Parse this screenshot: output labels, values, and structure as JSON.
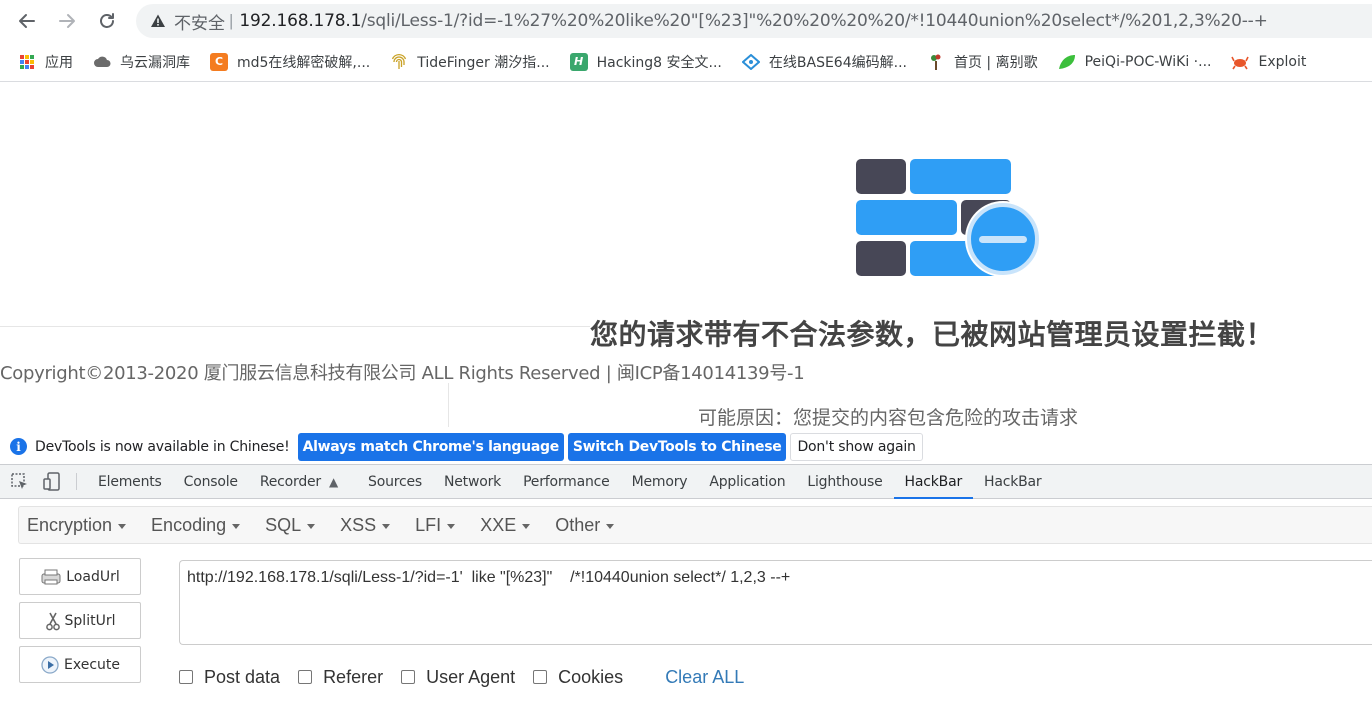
{
  "address_bar": {
    "insecure_label": "不安全",
    "separator": "|",
    "host": "192.168.178.1",
    "path": "/sqli/Less-1/?id=-1%27%20%20like%20\"[%23]\"%20%20%20%20/*!10440union%20select*/%201,2,3%20--+"
  },
  "bookmarks": [
    {
      "label": "应用",
      "icon": "apps-grid-icon"
    },
    {
      "label": "乌云漏洞库",
      "icon": "cloud-icon"
    },
    {
      "label": "md5在线解密破解,...",
      "icon": "cmd5-icon"
    },
    {
      "label": "TideFinger 潮汐指...",
      "icon": "fingerprint-icon"
    },
    {
      "label": "Hacking8 安全文...",
      "icon": "hacking8-icon"
    },
    {
      "label": "在线BASE64编码解...",
      "icon": "base64-icon"
    },
    {
      "label": "首页 | 离别歌",
      "icon": "plant-icon"
    },
    {
      "label": "PeiQi-POC-WiKi ·...",
      "icon": "leaf-icon"
    },
    {
      "label": "Exploit",
      "icon": "crab-icon"
    }
  ],
  "block_page": {
    "title": "您的请求带有不合法参数，已被网站管理员设置拦截！",
    "copyright": "Copyright©2013-2020 厦门服云信息科技有限公司 ALL Rights Reserved | 闽ICP备14014139号-1",
    "reason": "可能原因：您提交的内容包含危险的攻击请求",
    "colors": {
      "brick_dark": "#474756",
      "brick_blue": "#2f9ef5"
    }
  },
  "devtools_infobar": {
    "message": "DevTools is now available in Chinese!",
    "btn_match": "Always match Chrome's language",
    "btn_switch": "Switch DevTools to Chinese",
    "btn_dismiss": "Don't show again"
  },
  "devtools_tabs": [
    {
      "label": "Elements",
      "active": false
    },
    {
      "label": "Console",
      "active": false
    },
    {
      "label": "Recorder",
      "active": false
    },
    {
      "label": "Sources",
      "active": false
    },
    {
      "label": "Network",
      "active": false
    },
    {
      "label": "Performance",
      "active": false
    },
    {
      "label": "Memory",
      "active": false
    },
    {
      "label": "Application",
      "active": false
    },
    {
      "label": "Lighthouse",
      "active": false
    },
    {
      "label": "HackBar",
      "active": true
    },
    {
      "label": "HackBar",
      "active": false
    }
  ],
  "hackbar": {
    "menu": [
      "Encryption",
      "Encoding",
      "SQL",
      "XSS",
      "LFI",
      "XXE",
      "Other"
    ],
    "buttons": {
      "load": "LoadUrl",
      "split": "SplitUrl",
      "execute": "Execute"
    },
    "url_value": "http://192.168.178.1/sqli/Less-1/?id=-1'  like \"[%23]\"    /*!10440union select*/ 1,2,3 --+",
    "checkboxes": [
      {
        "label": "Post data",
        "checked": false
      },
      {
        "label": "Referer",
        "checked": false
      },
      {
        "label": "User Agent",
        "checked": false
      },
      {
        "label": "Cookies",
        "checked": false
      }
    ],
    "clear_all": "Clear ALL"
  }
}
